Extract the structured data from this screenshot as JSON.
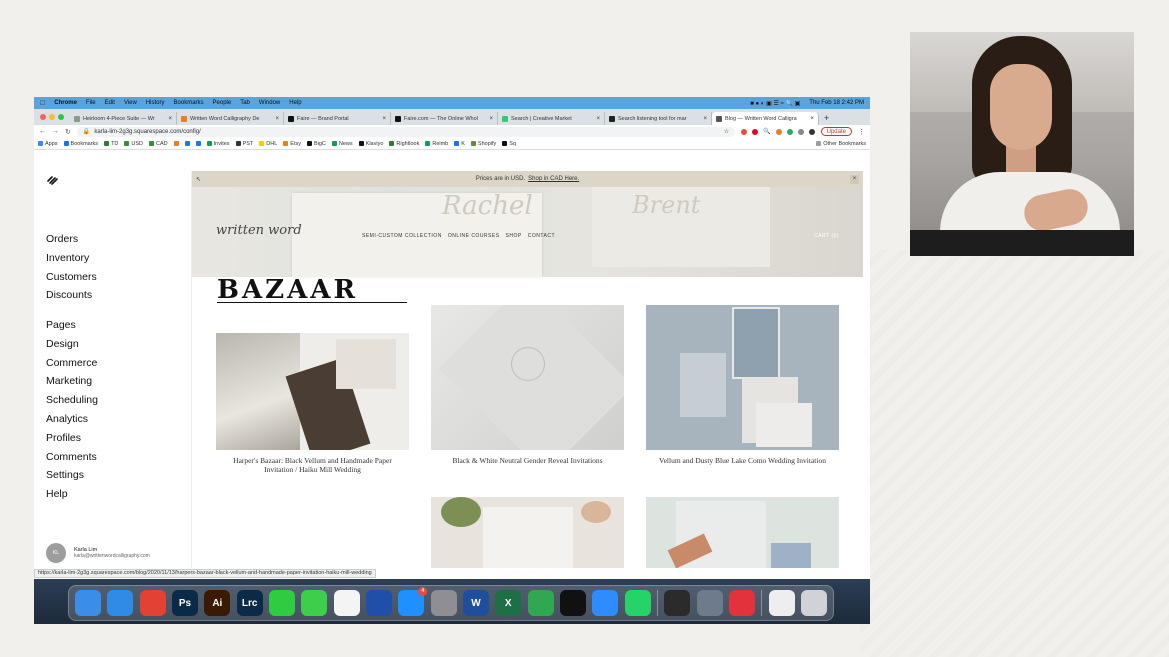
{
  "menubar": {
    "app": "Chrome",
    "items": [
      "File",
      "Edit",
      "View",
      "History",
      "Bookmarks",
      "People",
      "Tab",
      "Window",
      "Help"
    ],
    "clock": "Thu Feb 18  2:42 PM"
  },
  "tabs": [
    {
      "title": "Heirloom 4-Piece Suite — Wr",
      "color": "#8a9a8b",
      "active": false
    },
    {
      "title": "Written Word Calligraphy De",
      "color": "#e67e22",
      "active": false
    },
    {
      "title": "Faire — Brand Portal",
      "color": "#111111",
      "active": false
    },
    {
      "title": "Faire.com — The Online Whol",
      "color": "#111111",
      "active": false
    },
    {
      "title": "Search | Creative Market",
      "color": "#2ecc71",
      "active": false
    },
    {
      "title": "Search listening tool for mar",
      "color": "#222222",
      "active": false
    },
    {
      "title": "Blog — Written Word Calligra",
      "color": "#555555",
      "active": true
    }
  ],
  "address": {
    "url": "karla-lim-2g3g.squarespace.com/config/",
    "update_label": "Update"
  },
  "bookmarks": [
    {
      "label": "Apps",
      "color": "#4285f4"
    },
    {
      "label": "Bookmarks",
      "color": "#1a73e8"
    },
    {
      "label": "TD",
      "color": "#2e7d32"
    },
    {
      "label": "USD",
      "color": "#388e3c"
    },
    {
      "label": "CAD",
      "color": "#388e3c"
    },
    {
      "label": "",
      "color": "#e67e22"
    },
    {
      "label": "",
      "color": "#1877f2"
    },
    {
      "label": "",
      "color": "#1877f2"
    },
    {
      "label": "Invites",
      "color": "#0f9d58"
    },
    {
      "label": "PST",
      "color": "#333333"
    },
    {
      "label": "DHL",
      "color": "#ffcc00"
    },
    {
      "label": "Etsy",
      "color": "#e67e22"
    },
    {
      "label": "BigC",
      "color": "#111111"
    },
    {
      "label": "News",
      "color": "#0f9d58"
    },
    {
      "label": "Klaviyo",
      "color": "#111111"
    },
    {
      "label": "Rightlook",
      "color": "#2e7d32"
    },
    {
      "label": "Reimb",
      "color": "#0f9d58"
    },
    {
      "label": "K",
      "color": "#1a73e8"
    },
    {
      "label": "Shopify",
      "color": "#5e8e3e"
    },
    {
      "label": "Sq",
      "color": "#111111"
    }
  ],
  "other_bookmarks": "Other Bookmarks",
  "sidebar": {
    "group1": [
      "Orders",
      "Inventory",
      "Customers",
      "Discounts"
    ],
    "group2": [
      "Pages",
      "Design",
      "Commerce",
      "Marketing",
      "Scheduling",
      "Analytics",
      "Profiles",
      "Comments",
      "Settings",
      "Help"
    ],
    "user": {
      "initials": "KL",
      "name": "Karla Lim",
      "email": "karla@writtenwordcalligraphy.com"
    }
  },
  "status_url": "https://karla-lim-2g3g.squarespace.com/blog/2020/11/13/harpers-bazaar-black-vellum-and-handmade-paper-invitation-haiku-mill-wedding",
  "preview": {
    "banner_text": "Prices are in USD.",
    "banner_link": "Shop in CAD Here.",
    "brand": "written word",
    "nav": [
      "SEMI-CUSTOM COLLECTION",
      "ONLINE COURSES",
      "SHOP",
      "CONTACT"
    ],
    "cart": "CART (0)",
    "bazaar": "BAZAAR",
    "posts": [
      {
        "title": "Harper's Bazaar: Black Vellum and Handmade Paper Invitation / Haiku Mill Wedding"
      },
      {
        "title": "Black & White Neutral Gender Reveal Invitations"
      },
      {
        "title": "Vellum and Dusty Blue Lake Como Wedding Invitation"
      },
      {
        "title": ""
      },
      {
        "title": ""
      }
    ]
  },
  "dock": {
    "apps": [
      {
        "name": "finder-icon",
        "label": "",
        "color": "#3b8ee8"
      },
      {
        "name": "safari-icon",
        "label": "",
        "color": "#2f8be6"
      },
      {
        "name": "chrome-icon",
        "label": "",
        "color": "#e34133"
      },
      {
        "name": "photoshop-icon",
        "label": "Ps",
        "color": "#0b2a4a"
      },
      {
        "name": "illustrator-icon",
        "label": "Ai",
        "color": "#3a1a03"
      },
      {
        "name": "lightroom-icon",
        "label": "Lrc",
        "color": "#0b2a4a"
      },
      {
        "name": "facetime-icon",
        "label": "",
        "color": "#2ecc40"
      },
      {
        "name": "messages-icon",
        "label": "",
        "color": "#3ecf4a"
      },
      {
        "name": "photos-icon",
        "label": "",
        "color": "#f4f4f4"
      },
      {
        "name": "image-capture-icon",
        "label": "",
        "color": "#1f4fa8"
      },
      {
        "name": "app-store-icon",
        "label": "",
        "color": "#1e90ff",
        "badge": "4"
      },
      {
        "name": "system-preferences-icon",
        "label": "",
        "color": "#8e8e93"
      },
      {
        "name": "word-icon",
        "label": "W",
        "color": "#1e4e9c"
      },
      {
        "name": "excel-icon",
        "label": "X",
        "color": "#1d7045"
      },
      {
        "name": "numbers-icon",
        "label": "",
        "color": "#2fa84f"
      },
      {
        "name": "acrobat-icon",
        "label": "",
        "color": "#111111"
      },
      {
        "name": "zoom-icon",
        "label": "",
        "color": "#2d8cff"
      },
      {
        "name": "whatsapp-icon",
        "label": "",
        "color": "#25d366"
      },
      {
        "name": "quicktime-icon",
        "label": "",
        "color": "#2b2b2b"
      },
      {
        "name": "launchpad-icon",
        "label": "",
        "color": "#6e7b8c"
      },
      {
        "name": "creative-cloud-icon",
        "label": "",
        "color": "#e3323c"
      },
      {
        "name": "document-icon",
        "label": "",
        "color": "#eeeeee"
      },
      {
        "name": "trash-icon",
        "label": "",
        "color": "#cfd3d8"
      }
    ]
  }
}
